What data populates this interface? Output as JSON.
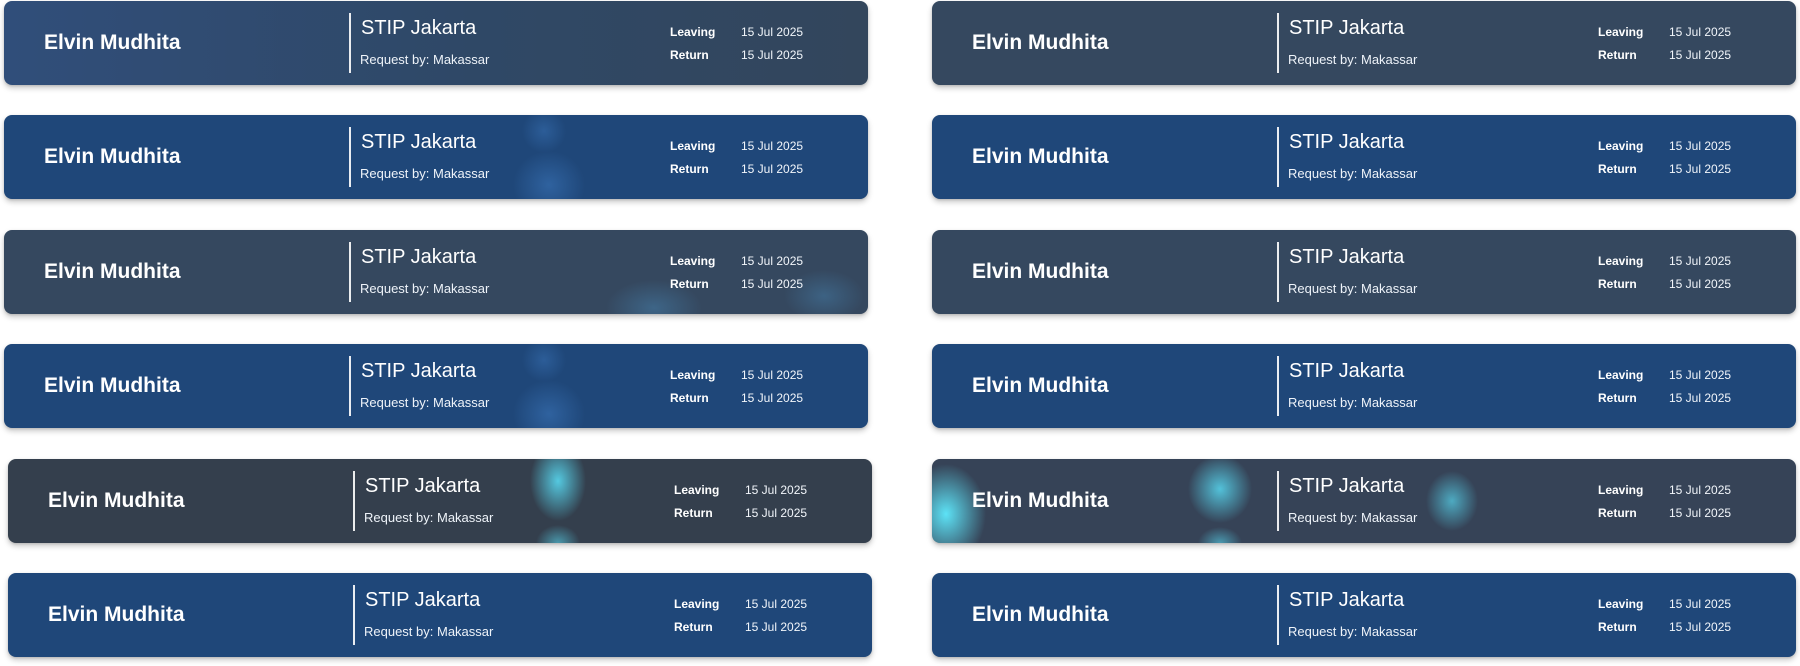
{
  "cards": [
    {
      "name": "Elvin Mudhita",
      "destination": "STIP Jakarta",
      "request": "Request by: Makassar",
      "leaving_label": "Leaving",
      "leaving_date": "15 Jul 2025",
      "return_label": "Return",
      "return_date": "15 Jul 2025"
    },
    {
      "name": "Elvin Mudhita",
      "destination": "STIP Jakarta",
      "request": "Request by: Makassar",
      "leaving_label": "Leaving",
      "leaving_date": "15 Jul 2025",
      "return_label": "Return",
      "return_date": "15 Jul 2025"
    },
    {
      "name": "Elvin Mudhita",
      "destination": "STIP Jakarta",
      "request": "Request by: Makassar",
      "leaving_label": "Leaving",
      "leaving_date": "15 Jul 2025",
      "return_label": "Return",
      "return_date": "15 Jul 2025"
    },
    {
      "name": "Elvin Mudhita",
      "destination": "STIP Jakarta",
      "request": "Request by: Makassar",
      "leaving_label": "Leaving",
      "leaving_date": "15 Jul 2025",
      "return_label": "Return",
      "return_date": "15 Jul 2025"
    },
    {
      "name": "Elvin Mudhita",
      "destination": "STIP Jakarta",
      "request": "Request by: Makassar",
      "leaving_label": "Leaving",
      "leaving_date": "15 Jul 2025",
      "return_label": "Return",
      "return_date": "15 Jul 2025"
    },
    {
      "name": "Elvin Mudhita",
      "destination": "STIP Jakarta",
      "request": "Request by: Makassar",
      "leaving_label": "Leaving",
      "leaving_date": "15 Jul 2025",
      "return_label": "Return",
      "return_date": "15 Jul 2025"
    },
    {
      "name": "Elvin Mudhita",
      "destination": "STIP Jakarta",
      "request": "Request by: Makassar",
      "leaving_label": "Leaving",
      "leaving_date": "15 Jul 2025",
      "return_label": "Return",
      "return_date": "15 Jul 2025"
    },
    {
      "name": "Elvin Mudhita",
      "destination": "STIP Jakarta",
      "request": "Request by: Makassar",
      "leaving_label": "Leaving",
      "leaving_date": "15 Jul 2025",
      "return_label": "Return",
      "return_date": "15 Jul 2025"
    },
    {
      "name": "Elvin Mudhita",
      "destination": "STIP Jakarta",
      "request": "Request by: Makassar",
      "leaving_label": "Leaving",
      "leaving_date": "15 Jul 2025",
      "return_label": "Return",
      "return_date": "15 Jul 2025"
    },
    {
      "name": "Elvin Mudhita",
      "destination": "STIP Jakarta",
      "request": "Request by: Makassar",
      "leaving_label": "Leaving",
      "leaving_date": "15 Jul 2025",
      "return_label": "Return",
      "return_date": "15 Jul 2025"
    },
    {
      "name": "Elvin Mudhita",
      "destination": "STIP Jakarta",
      "request": "Request by: Makassar",
      "leaving_label": "Leaving",
      "leaving_date": "15 Jul 2025",
      "return_label": "Return",
      "return_date": "15 Jul 2025"
    },
    {
      "name": "Elvin Mudhita",
      "destination": "STIP Jakarta",
      "request": "Request by: Makassar",
      "leaving_label": "Leaving",
      "leaving_date": "15 Jul 2025",
      "return_label": "Return",
      "return_date": "15 Jul 2025"
    }
  ],
  "colors": {
    "navy": "#1f4779",
    "slate": "#35485f",
    "cyan_glow": "#5ae1fa",
    "text": "#ffffff"
  }
}
